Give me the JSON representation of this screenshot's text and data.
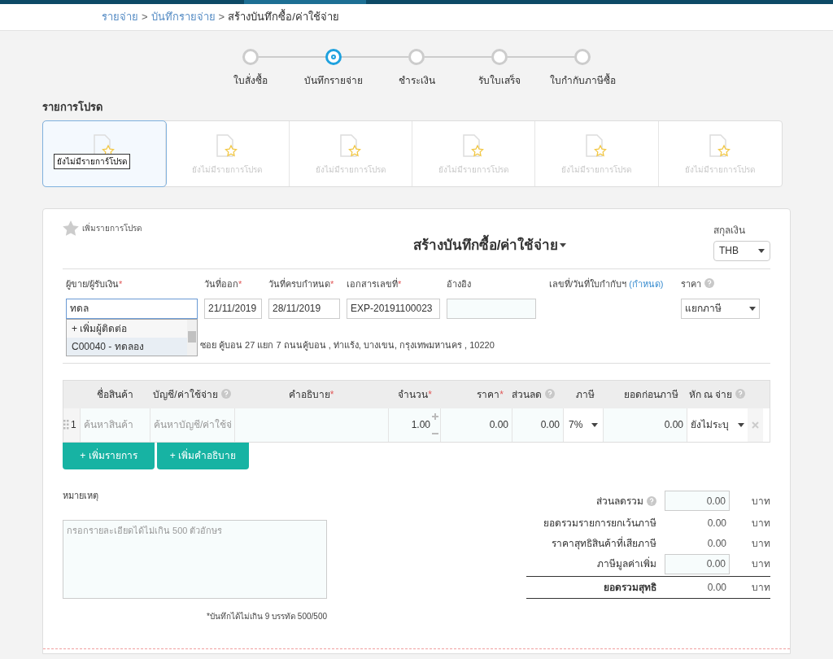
{
  "breadcrumb": [
    {
      "label": "รายจ่าย",
      "link": true
    },
    {
      "label": "บันทึกรายจ่าย",
      "link": true
    },
    {
      "label": "สร้างบันทึกซื้อ/ค่าใช้จ่าย",
      "link": false
    }
  ],
  "separator": ">",
  "steps": [
    {
      "label": "ใบสั่งซื้อ",
      "selected": false
    },
    {
      "label": "บันทึกรายจ่าย",
      "selected": true
    },
    {
      "label": "ชำระเงิน",
      "selected": false
    },
    {
      "label": "รับใบเสร็จ",
      "selected": false
    },
    {
      "label": "ใบกำกับภาษีซื้อ",
      "selected": false
    }
  ],
  "favorites": {
    "title": "รายการโปรด",
    "tooltip": "ยังไม่มีรายการ์โปรด",
    "cards": [
      {
        "selected": true
      },
      {
        "label": "ยังไม่มีรายการโปรด",
        "selected": false
      },
      {
        "label": "ยังไม่มีรายการโปรด",
        "selected": false
      },
      {
        "label": "ยังไม่มีรายการโปรด",
        "selected": false
      },
      {
        "label": "ยังไม่มีรายการโปรด",
        "selected": false
      },
      {
        "label": "ยังไม่มีรายการโปรด",
        "selected": false
      }
    ]
  },
  "form": {
    "add_favorite": "เพิ่มรายการโปรด",
    "title": "สร้างบันทึกซื้อ/ค่าใช้จ่าย",
    "currency": {
      "label": "สกุลเงิน",
      "value": "THB"
    },
    "fields": [
      {
        "label": "ผู้ขาย/ผู้รับเงิน",
        "mark": "*",
        "value": "ทดล",
        "kind": "input",
        "focused": true
      },
      {
        "label": "วันที่ออก",
        "mark": "*",
        "value": "21/11/2019",
        "kind": "input",
        "focused": false
      },
      {
        "label": "วันที่ครบกำหนด",
        "mark": "*",
        "value": "28/11/2019",
        "kind": "input",
        "focused": false
      },
      {
        "label": "เอกสารเลขที่",
        "mark": "*",
        "value": "EXP-20191100023",
        "kind": "input",
        "focused": false
      },
      {
        "label": "อ้างอิง",
        "kind": "input",
        "focused": false
      },
      {
        "label": "เลขที่/วันที่ใบกำกับฯ",
        "link": "(กำหนด)",
        "kind": "none"
      },
      {
        "label": "ราคา",
        "help": true,
        "value": "แยกภาษี",
        "kind": "select"
      }
    ],
    "suggestions": [
      {
        "label": "+ เพิ่มผู้ติดต่อ",
        "selected": false
      },
      {
        "label": "C00040 - ทดลอง",
        "selected": true
      }
    ],
    "address": "ซอย คู้บอน 27 แยก 7 ถนนคู้บอน , ท่าแร้ง, บางเขน, กรุงเทพมหานคร , 10220"
  },
  "table": {
    "columns": [
      {},
      {
        "label": "ชื่อสินค้า"
      },
      {
        "label": "บัญชี/ค่าใช้จ่าย",
        "help": true
      },
      {
        "label": "คำอธิบาย",
        "mark": "*"
      },
      {
        "label": "จำนวน",
        "mark": "*"
      },
      {
        "label": "ราคา",
        "mark": "*"
      },
      {
        "label": "ส่วนลด",
        "help": true
      },
      {
        "label": "ภาษี"
      },
      {
        "label": "ยอดก่อนภาษี"
      },
      {
        "label": "หัก ณ จ่าย",
        "help": true
      },
      {}
    ],
    "rows": [
      {
        "number": "1",
        "product_placeholder": "ค้นหาสินค้า",
        "account_placeholder": "ค้นหาบัญชี/ค่าใช้จ่",
        "quantity": "1.00",
        "price": "0.00",
        "discount": "0.00",
        "tax": "7%",
        "pre_tax": "0.00",
        "withholding": "ยังไม่ระบุ"
      }
    ]
  },
  "buttons": [
    "+ เพิ่มรายการ",
    "+ เพิ่มคำอธิบาย"
  ],
  "notes": {
    "label": "หมายเหตุ",
    "placeholder": "กรอกรายละเอียดได้ไม่เกิน 500 ตัวอักษร",
    "hint": "*บันทึกได้ไม่เกิน 9 บรรทัด 500/500"
  },
  "totals": [
    {
      "label": "ส่วนลดรวม",
      "help": true,
      "value": "0.00",
      "unit": "บาท",
      "kind": "input"
    },
    {
      "label": "ยอดรวมรายการยกเว้นภาษี",
      "value": "0.00",
      "unit": "บาท",
      "kind": "text"
    },
    {
      "label": "ราคาสุทธิสินค้าที่เสียภาษี",
      "value": "0.00",
      "unit": "บาท",
      "kind": "text"
    },
    {
      "label": "ภาษีมูลค่าเพิ่ม",
      "value": "0.00",
      "unit": "บาท",
      "kind": "input"
    },
    {
      "label": "ยอดรวมสุทธิ",
      "value": "0.00",
      "unit": "บาท",
      "kind": "total"
    }
  ]
}
